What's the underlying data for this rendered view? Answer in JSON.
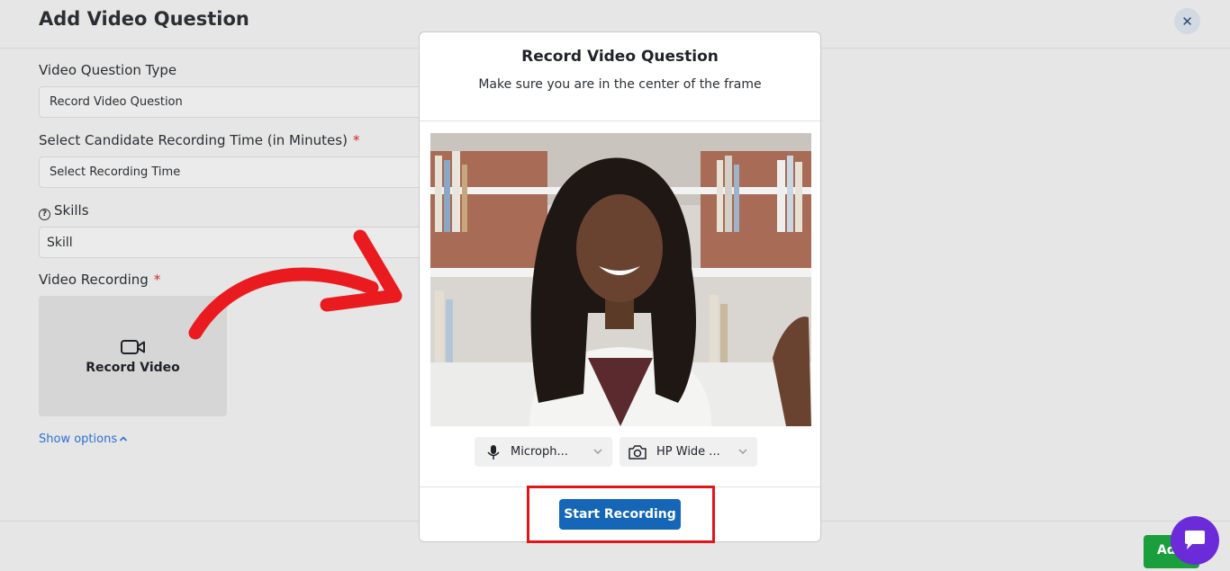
{
  "header": {
    "title": "Add Video Question",
    "close_icon": "close-icon"
  },
  "form": {
    "type_label": "Video Question Type",
    "type_value": "Record Video Question",
    "time_label": "Select Candidate Recording Time (in Minutes)",
    "time_placeholder": "Select Recording Time",
    "skills_label": "Skills",
    "skills_value": "Skill",
    "recording_label": "Video Recording",
    "required_mark": "*",
    "record_tile_label": "Record Video",
    "show_options": "Show options"
  },
  "modal": {
    "title": "Record Video Question",
    "subtitle": "Make sure you are in the center of the frame",
    "mic_label": "Microph...",
    "camera_label": "HP Wide ...",
    "start_button": "Start Recording"
  },
  "footer": {
    "add_label": "Add"
  },
  "colors": {
    "accent": "#1566b6",
    "annotation": "#e3151a",
    "add": "#1a9f3c",
    "chat": "#6c2bd9"
  }
}
